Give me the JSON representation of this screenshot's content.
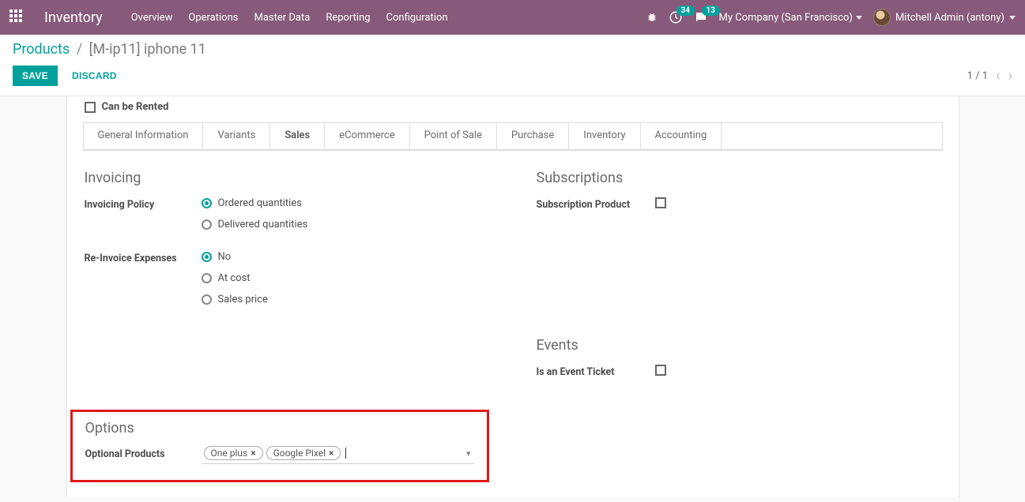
{
  "topbar": {
    "brand": "Inventory",
    "menu": [
      "Overview",
      "Operations",
      "Master Data",
      "Reporting",
      "Configuration"
    ],
    "clock_badge": "34",
    "chat_badge": "13",
    "company": "My Company (San Francisco)",
    "user": "Mitchell Admin (antony)"
  },
  "breadcrumb": {
    "root": "Products",
    "current": "[M-ip11] iphone 11"
  },
  "actions": {
    "save": "SAVE",
    "discard": "DISCARD",
    "pager": "1 / 1"
  },
  "rented": {
    "label": "Can be Rented",
    "checked": false
  },
  "tabs": [
    "General Information",
    "Variants",
    "Sales",
    "eCommerce",
    "Point of Sale",
    "Purchase",
    "Inventory",
    "Accounting"
  ],
  "active_tab": "Sales",
  "sales": {
    "invoicing_h": "Invoicing",
    "invoicing_policy_label": "Invoicing Policy",
    "invoicing_policy_options": [
      "Ordered quantities",
      "Delivered quantities"
    ],
    "invoicing_policy_selected": "Ordered quantities",
    "reinvoice_label": "Re-Invoice Expenses",
    "reinvoice_options": [
      "No",
      "At cost",
      "Sales price"
    ],
    "reinvoice_selected": "No",
    "subscriptions_h": "Subscriptions",
    "subscription_product_label": "Subscription Product",
    "subscription_product_checked": false,
    "events_h": "Events",
    "event_ticket_label": "Is an Event Ticket",
    "event_ticket_checked": false,
    "options_h": "Options",
    "optional_products_label": "Optional Products",
    "optional_products_tags": [
      "One plus",
      "Google Pixel"
    ]
  }
}
